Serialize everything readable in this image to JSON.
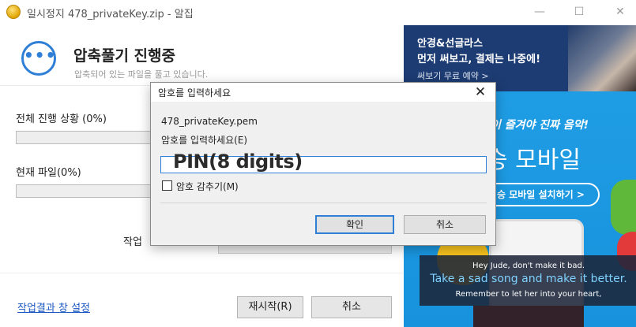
{
  "window": {
    "title": "일시정지 478_privateKey.zip - 알집",
    "minimize": "—",
    "maximize": "☐",
    "close": "✕"
  },
  "header": {
    "icon": "•••",
    "title": "압축풀기 진행중",
    "subtitle": "압축되어 있는 파일을 풀고 있습니다."
  },
  "progress": {
    "total_label": "전체 진행 상황 (0%)",
    "total_fraction": 0,
    "current_label": "현재 파일(0%)",
    "current_fraction": 0,
    "work_label": "작업"
  },
  "footer": {
    "settings_link": "작업결과 창 설정",
    "restart_button": "재시작(R)",
    "cancel_button": "취소"
  },
  "ad": {
    "top_line1": "안경&선글라스",
    "top_line2": "먼저 써보고, 결제는 나중에!",
    "top_line3": "써보기 무료 예약 >",
    "script_text": "이 즐겨야 진짜 음악!",
    "big_text": "승 모바일",
    "pill_text": "승 모바일 설치하기 >",
    "lyric1": "Hey Jude, don't make it bad.",
    "lyric2": "Take a sad song and make it better.",
    "lyric3": "Remember to let her into your heart,"
  },
  "dialog": {
    "title": "암호를 입력하세요",
    "close": "✕",
    "filename": "478_privateKey.pem",
    "prompt": "암호를 입력하세요(E)",
    "input_value": "",
    "overlay_text": "PIN(8 digits)",
    "hide_checkbox_label": "암호 감추기(M)",
    "ok_button": "확인",
    "cancel_button": "취소"
  },
  "colors": {
    "accent": "#2f7fd6",
    "link": "#1a57c2",
    "ad_blue": "#1b8fd8"
  }
}
